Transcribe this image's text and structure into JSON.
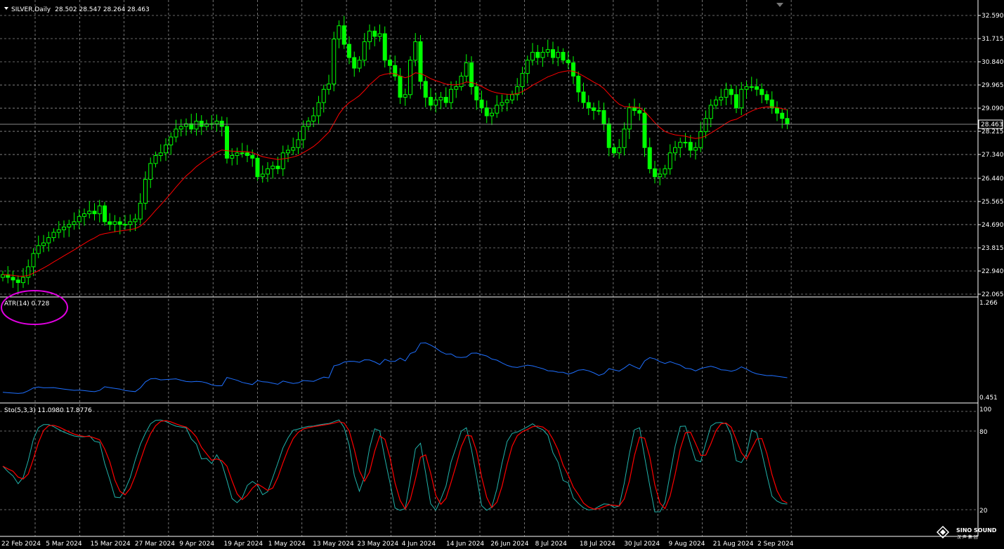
{
  "header": {
    "symbol": "SILVER,Daily",
    "ohlc": "28.502 28.547 28.264 28.463"
  },
  "atr": {
    "label": "ATR(14) 0.728",
    "ymax": "1.266",
    "ymin": "0.451"
  },
  "stoch": {
    "label": "Sto(5,3,3) 11.0980 17.8776",
    "levels": [
      "100",
      "80",
      "20"
    ]
  },
  "price_axis": [
    "32.590",
    "31.715",
    "30.840",
    "29.965",
    "29.090",
    "28.215",
    "27.340",
    "26.440",
    "25.565",
    "24.690",
    "23.815",
    "22.940",
    "22.065"
  ],
  "current_price": "28.463",
  "date_axis": [
    "22 Feb 2024",
    "5 Mar 2024",
    "15 Mar 2024",
    "27 Mar 2024",
    "9 Apr 2024",
    "19 Apr 2024",
    "1 May 2024",
    "13 May 2024",
    "23 May 2024",
    "4 Jun 2024",
    "14 Jun 2024",
    "26 Jun 2024",
    "8 Jul 2024",
    "18 Jul 2024",
    "30 Jul 2024",
    "9 Aug 2024",
    "21 Aug 2024",
    "2 Sep 2024"
  ],
  "logo": {
    "title": "SINO SOUND",
    "subtitle": "汉 声 集 团"
  },
  "colors": {
    "bull": "#00ff00",
    "ma": "#ff0000",
    "atr": "#1e6fff",
    "k": "#20b2aa",
    "d": "#ff0000",
    "grid": "#ffffff",
    "bg": "#000000",
    "highlight": "#e100e1"
  },
  "chart_data": {
    "type": "candlestick",
    "title": "SILVER,Daily",
    "ylim": [
      22.065,
      32.59
    ],
    "closes": [
      22.8,
      22.7,
      22.6,
      22.5,
      22.7,
      23.1,
      23.6,
      23.9,
      24.0,
      24.2,
      24.4,
      24.5,
      24.6,
      24.7,
      24.8,
      25.0,
      25.1,
      25.2,
      25.1,
      25.4,
      24.8,
      24.7,
      24.8,
      24.7,
      24.7,
      24.8,
      24.9,
      25.5,
      26.4,
      27.0,
      27.3,
      27.4,
      27.7,
      28.0,
      28.3,
      28.4,
      28.5,
      28.3,
      28.6,
      28.4,
      28.5,
      28.5,
      28.6,
      28.4,
      27.2,
      27.3,
      27.4,
      27.4,
      27.3,
      27.2,
      26.5,
      26.6,
      26.8,
      26.9,
      26.8,
      27.4,
      27.5,
      27.6,
      27.9,
      28.4,
      28.6,
      28.8,
      29.3,
      29.8,
      30.0,
      31.7,
      32.2,
      31.5,
      31.0,
      30.6,
      30.9,
      31.6,
      32.0,
      31.8,
      31.9,
      30.9,
      30.7,
      30.3,
      29.5,
      29.6,
      30.9,
      31.6,
      30.1,
      29.5,
      29.2,
      29.4,
      29.5,
      29.3,
      29.8,
      29.9,
      30.3,
      30.8,
      29.9,
      29.4,
      29.1,
      28.8,
      28.9,
      29.2,
      29.3,
      29.4,
      29.6,
      29.9,
      30.4,
      30.9,
      31.2,
      31.0,
      31.2,
      31.3,
      31.0,
      31.2,
      30.9,
      30.8,
      30.3,
      29.7,
      29.3,
      29.1,
      29.0,
      29.0,
      28.5,
      27.6,
      27.4,
      27.6,
      28.3,
      29.1,
      29.0,
      28.9,
      27.6,
      26.8,
      26.5,
      26.6,
      26.8,
      27.4,
      27.6,
      27.8,
      27.8,
      27.5,
      27.6,
      28.2,
      28.7,
      29.2,
      29.4,
      29.5,
      29.8,
      29.6,
      29.1,
      29.8,
      29.9,
      29.9,
      29.8,
      29.6,
      29.4,
      29.1,
      28.9,
      28.7,
      28.5
    ]
  }
}
